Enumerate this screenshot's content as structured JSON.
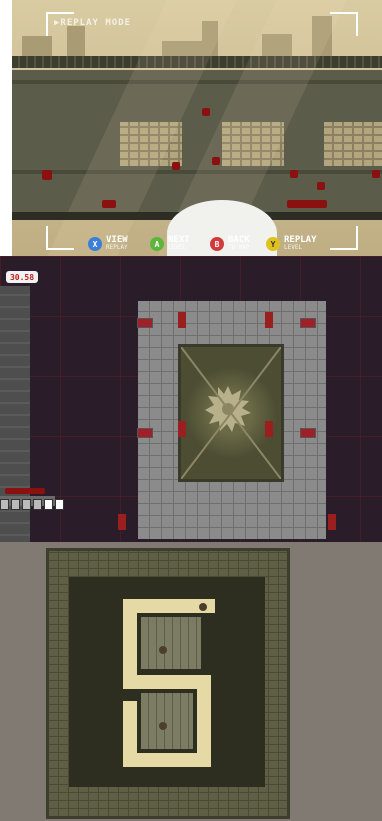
{
  "replay": {
    "mode_label": "▶REPLAY MODE",
    "actions": [
      {
        "key": "X",
        "color": "#3b7fd9",
        "label": "VIEW",
        "sub": "REPLAY"
      },
      {
        "key": "A",
        "color": "#5db53a",
        "label": "NEXT",
        "sub": "LEVEL"
      },
      {
        "key": "B",
        "color": "#d13b3b",
        "label": "BACK",
        "sub": "TO MAP"
      },
      {
        "key": "Y",
        "color": "#e0c21d",
        "label": "REPLAY",
        "sub": "LEVEL"
      }
    ]
  },
  "level": {
    "timer": "30.58"
  },
  "colors": {
    "blood": "#8b1010",
    "hud_text": "#ffffff",
    "timer_text": "#c21f1f"
  }
}
